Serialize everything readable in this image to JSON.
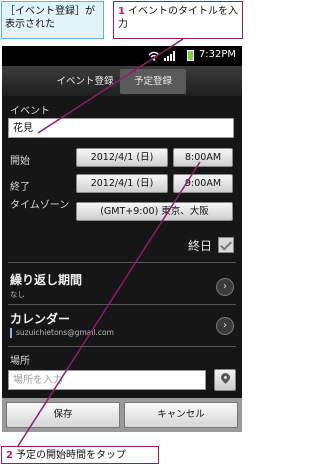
{
  "annotations": {
    "caption": "［イベント登録］が表示された",
    "step1_number": "1",
    "step1_text": "イベントのタイトルを入力",
    "step2_number": "2",
    "step2_text": "予定の開始時間をタップ"
  },
  "status_bar": {
    "time": "7:32PM"
  },
  "tabs": [
    {
      "label": "イベント登録",
      "selected": false
    },
    {
      "label": "予定登録",
      "selected": true
    }
  ],
  "form": {
    "event_label": "イベント",
    "event_value": "花見",
    "start_label": "開始",
    "start_date": "2012/4/1 (日)",
    "start_time": "8:00AM",
    "end_label": "終了",
    "end_date": "2012/4/1 (日)",
    "end_time": "9:00AM",
    "timezone_label": "タイムゾーン",
    "timezone_value": "(GMT+9:00) 東京、大阪",
    "allday_label": "終日",
    "allday_checked": true,
    "repeat_title": "繰り返し期間",
    "repeat_value": "なし",
    "calendar_title": "カレンダー",
    "calendar_account": "suzuichietons@gmail.com",
    "location_label": "場所",
    "location_placeholder": "場所を入力"
  },
  "buttons": {
    "save": "保存",
    "cancel": "キャンセル"
  },
  "colors": {
    "accent_callout": "#c0187f",
    "info_callout_bg": "#e3f3fa"
  }
}
